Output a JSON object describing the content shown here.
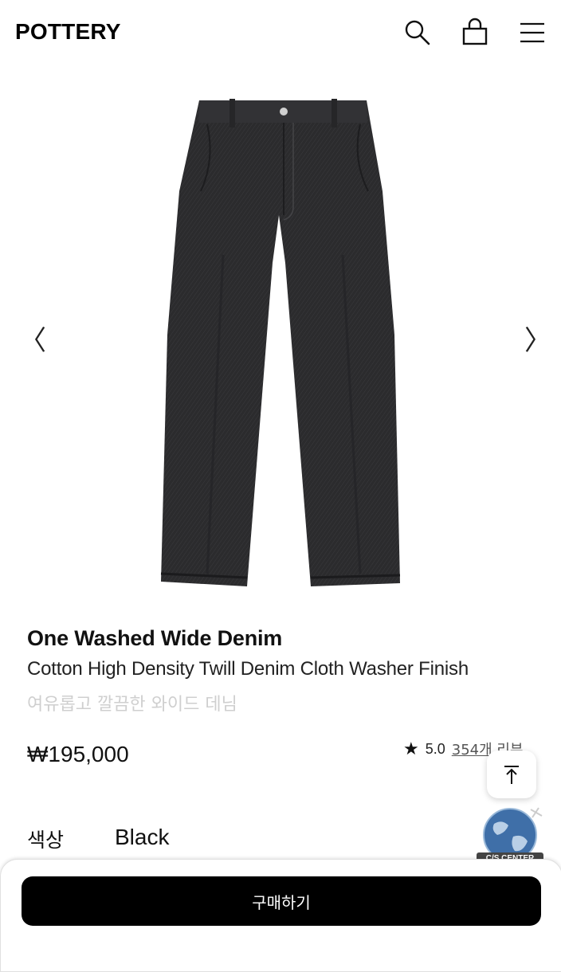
{
  "header": {
    "logo": "POTTERY",
    "icons": [
      "search-icon",
      "shopping-bag-icon",
      "hamburger-menu-icon"
    ]
  },
  "gallery": {
    "prev_arrow": "〈",
    "next_arrow": "〉"
  },
  "product": {
    "name": "One Washed Wide Denim",
    "subtitle": "Cotton High Density Twill Denim Cloth Washer Finish",
    "korean_subtitle": "여유롭고 깔끔한 와이드 데님",
    "price": "₩195,000",
    "rating": "5.0",
    "review_count": "354개 리뷰"
  },
  "options": {
    "color_label": "색상",
    "color_value": "Black"
  },
  "floating": {
    "cs_label": "C/S CENTER"
  },
  "cta": {
    "buy_label": "구매하기"
  },
  "colors": {
    "denim": "#2a2a2c",
    "button_bg": "#000000",
    "muted_text": "#cfcfcf"
  }
}
